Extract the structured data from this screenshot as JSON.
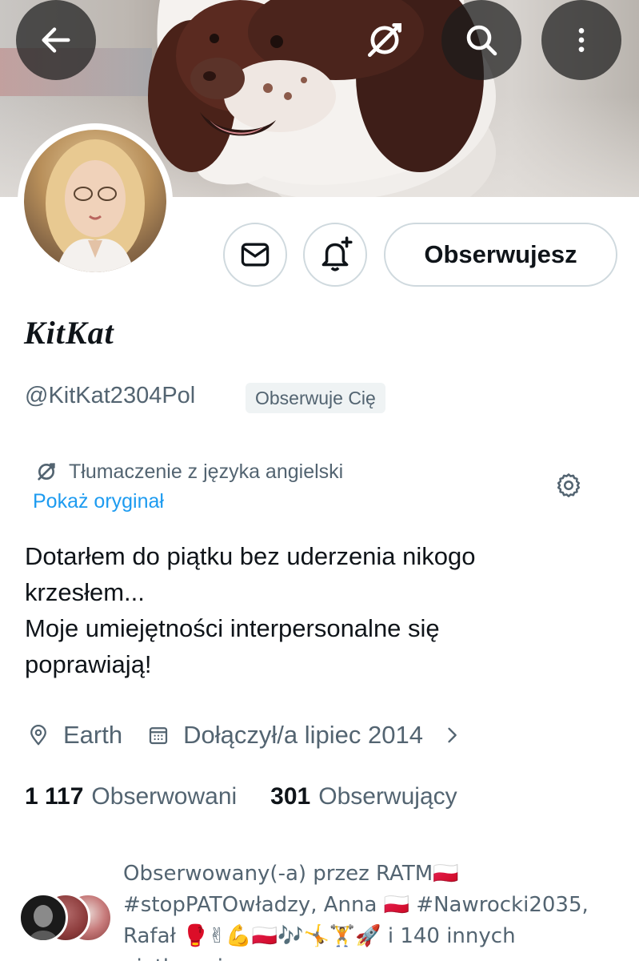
{
  "header": {
    "back_icon": "arrow-left-icon",
    "translate_icon": "translate-icon",
    "search_icon": "search-icon",
    "more_icon": "more-vertical-icon"
  },
  "profile": {
    "display_name": "KitKat",
    "handle": "@KitKat2304Pol",
    "follows_you_badge": "Obserwuje Cię",
    "follow_button_label": "Obserwujesz"
  },
  "translation": {
    "label": "Tłumaczenie z języka angielski",
    "show_original": "Pokaż oryginał"
  },
  "bio": {
    "lines": [
      "Dotarłem do piątku bez uderzenia nikogo",
      "krzesłem...",
      "Moje umiejętności interpersonalne się",
      "poprawiają!"
    ]
  },
  "meta": {
    "location": "Earth",
    "joined": "Dołączył/a lipiec 2014"
  },
  "stats": {
    "following_count": "1 117",
    "following_label": "Obserwowani",
    "followers_count": "301",
    "followers_label": "Obserwujący"
  },
  "followed_by": {
    "lines": [
      "Obserwowany(-a) przez RATM🇵🇱",
      "#stopPATOwładzy, Anna 🇵🇱 #Nawrocki2035,",
      "Rafał 🥊✌💪🇵🇱🎶🤸🏋🚀 i 140 innych",
      "pjetkowni..."
    ]
  },
  "colors": {
    "text_primary": "#0f1419",
    "text_secondary": "#536471",
    "link_blue": "#1d9bf0",
    "border": "#cfd9de"
  }
}
